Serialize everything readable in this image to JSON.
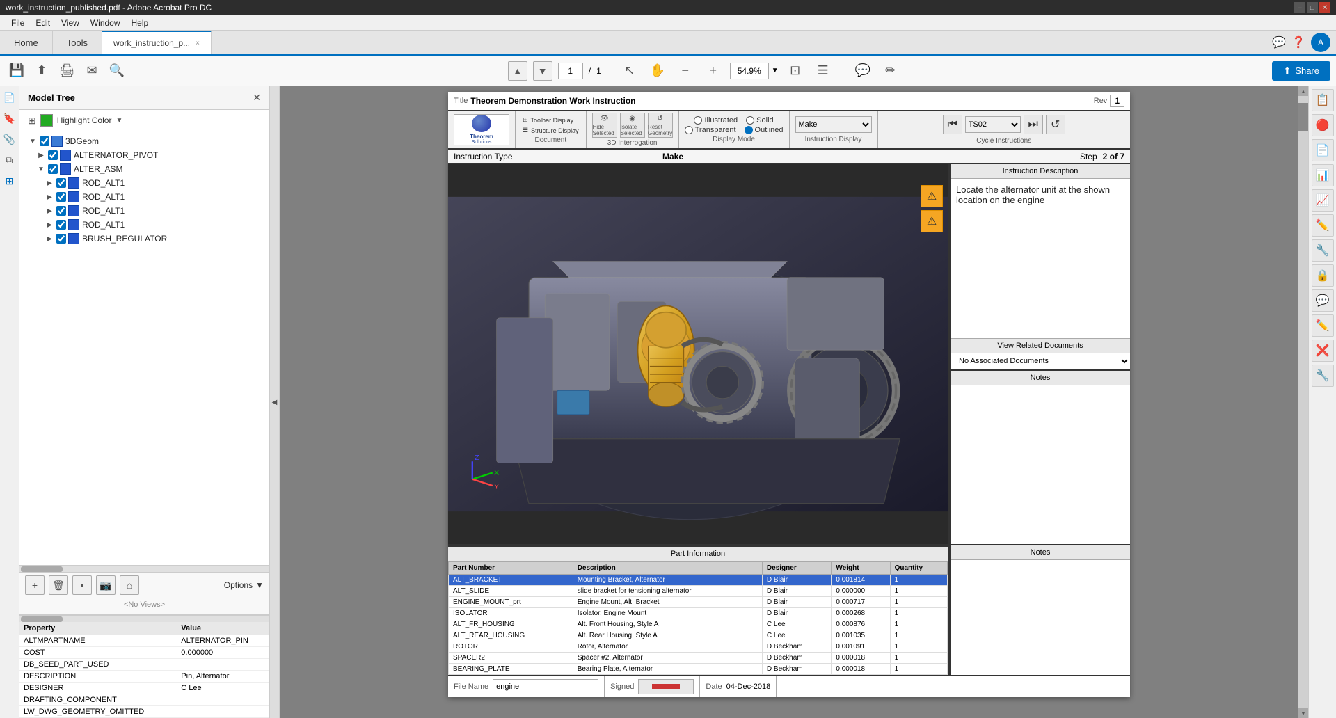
{
  "titlebar": {
    "title": "work_instruction_published.pdf - Adobe Acrobat Pro DC",
    "minimize": "–",
    "restore": "□",
    "close": "✕"
  },
  "menubar": {
    "items": [
      "File",
      "Edit",
      "View",
      "Window",
      "Help"
    ]
  },
  "tabs": {
    "home": "Home",
    "tools": "Tools",
    "doc": "work_instruction_p...",
    "close": "×"
  },
  "toolbar": {
    "page_current": "1",
    "page_total": "1",
    "zoom": "54.9%",
    "share": "Share"
  },
  "left_panel": {
    "title": "Model Tree",
    "highlight_color": "Highlight Color",
    "tree_nodes": [
      {
        "label": "3DGeom",
        "level": 0,
        "expanded": true,
        "has_checkbox": true
      },
      {
        "label": "ALTERNATOR_PIVOT",
        "level": 1,
        "expanded": false,
        "has_checkbox": true
      },
      {
        "label": "ALTER_ASM",
        "level": 1,
        "expanded": true,
        "has_checkbox": true
      },
      {
        "label": "ROD_ALT1",
        "level": 2,
        "expanded": false,
        "has_checkbox": true
      },
      {
        "label": "ROD_ALT1",
        "level": 2,
        "expanded": false,
        "has_checkbox": true
      },
      {
        "label": "ROD_ALT1",
        "level": 2,
        "expanded": false,
        "has_checkbox": true
      },
      {
        "label": "ROD_ALT1",
        "level": 2,
        "expanded": false,
        "has_checkbox": true
      },
      {
        "label": "BRUSH_REGULATOR",
        "level": 2,
        "expanded": false,
        "has_checkbox": true
      }
    ],
    "no_views": "<No Views>",
    "options_label": "Options",
    "properties": {
      "header_property": "Property",
      "header_value": "Value",
      "rows": [
        {
          "prop": "ALTMPARTNAME",
          "value": "ALTERNATOR_PIN"
        },
        {
          "prop": "COST",
          "value": "0.000000"
        },
        {
          "prop": "DB_SEED_PART_USED",
          "value": ""
        },
        {
          "prop": "DESCRIPTION",
          "value": "Pin, Alternator"
        },
        {
          "prop": "DESIGNER",
          "value": "C Lee"
        },
        {
          "prop": "DRAFTING_COMPONENT",
          "value": ""
        },
        {
          "prop": "LW_DWG_GEOMETRY_OMITTED",
          "value": ""
        }
      ]
    }
  },
  "pdf": {
    "header": {
      "title_label": "Title",
      "title_val": "Theorem Demonstration Work Instruction",
      "rev_label": "Rev",
      "rev_val": "1"
    },
    "logo": {
      "company": "Theorem Solutions"
    },
    "toolbar": {
      "document_label": "Document",
      "toolbar_display": "Toolbar Display",
      "structure_display": "Structure Display",
      "interrogation_label": "3D Interrogation",
      "hide_selected": "Hide Selected",
      "isolate_selected": "Isolate Selected",
      "reset_geometry": "Reset Geometry",
      "display_mode_label": "Display Mode",
      "display_modes": [
        "Illustrated",
        "Solid",
        "Transparent",
        "Outlined"
      ],
      "selected_display": "Outlined",
      "instruction_display_label": "Instruction Display",
      "make_option": "Make",
      "cycle_label": "Cycle Instructions",
      "cycle_val": "TS02"
    },
    "instruction": {
      "type_label": "Instruction Type",
      "make_label": "Make",
      "step_label": "Step",
      "step_val": "2 of 7"
    },
    "description": {
      "header": "Instruction Description",
      "text": "Locate the alternator unit at the shown location on the engine"
    },
    "related_docs": {
      "header": "View Related Documents",
      "value": "No Associated Documents"
    },
    "notes": {
      "header": "Notes",
      "text": ""
    },
    "part_info": {
      "header": "Part Information",
      "columns": [
        "Part Number",
        "Description",
        "Designer",
        "Weight",
        "Quantity"
      ],
      "rows": [
        {
          "part": "ALT_BRACKET",
          "desc": "Mounting Bracket, Alternator",
          "designer": "D Blair",
          "weight": "0.001814",
          "qty": "1",
          "highlight": true
        },
        {
          "part": "ALT_SLIDE",
          "desc": "slide bracket for tensioning alternator",
          "designer": "D Blair",
          "weight": "0.000000",
          "qty": "1",
          "highlight": false
        },
        {
          "part": "ENGINE_MOUNT_prt",
          "desc": "Engine Mount, Alt. Bracket",
          "designer": "D Blair",
          "weight": "0.000717",
          "qty": "1",
          "highlight": false
        },
        {
          "part": "ISOLATOR",
          "desc": "Isolator, Engine Mount",
          "designer": "D Blair",
          "weight": "0.000268",
          "qty": "1",
          "highlight": false
        },
        {
          "part": "ALT_FR_HOUSING",
          "desc": "Alt. Front Housing, Style A",
          "designer": "C Lee",
          "weight": "0.000876",
          "qty": "1",
          "highlight": false
        },
        {
          "part": "ALT_REAR_HOUSING",
          "desc": "Alt. Rear Housing, Style A",
          "designer": "C Lee",
          "weight": "0.001035",
          "qty": "1",
          "highlight": false
        },
        {
          "part": "ROTOR",
          "desc": "Rotor, Alternator",
          "designer": "D Beckham",
          "weight": "0.001091",
          "qty": "1",
          "highlight": false
        },
        {
          "part": "SPACER2",
          "desc": "Spacer #2, Alternator",
          "designer": "D Beckham",
          "weight": "0.000018",
          "qty": "1",
          "highlight": false
        },
        {
          "part": "BEARING_PLATE",
          "desc": "Bearing Plate, Alternator",
          "designer": "D Beckham",
          "weight": "0.000018",
          "qty": "1",
          "highlight": false
        }
      ]
    },
    "footer": {
      "file_name_label": "File Name",
      "file_name_val": "engine",
      "signed_label": "Signed",
      "date_label": "Date",
      "date_val": "04-Dec-2018"
    }
  },
  "right_toolbar": {
    "icons": [
      "📋",
      "🔴",
      "📄",
      "📊",
      "📈",
      "✏️",
      "🔧",
      "🔒",
      "💬",
      "✏️",
      "❌",
      "🔧"
    ]
  }
}
